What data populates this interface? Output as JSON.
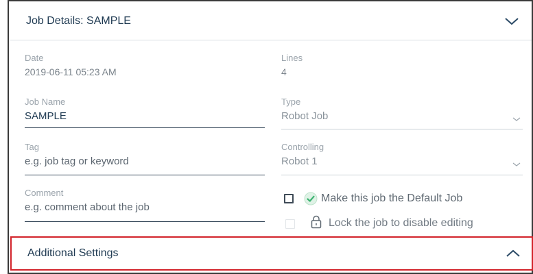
{
  "header": {
    "title": "Job Details: SAMPLE"
  },
  "fields": {
    "date": {
      "label": "Date",
      "value": "2019-06-11 05:23 AM"
    },
    "lines": {
      "label": "Lines",
      "value": "4"
    },
    "job_name": {
      "label": "Job Name",
      "value": "SAMPLE"
    },
    "type": {
      "label": "Type",
      "value": "Robot Job"
    },
    "tag": {
      "label": "Tag",
      "placeholder": "e.g. job tag or keyword"
    },
    "controlling": {
      "label": "Controlling",
      "value": "Robot 1"
    },
    "comment": {
      "label": "Comment",
      "placeholder": "e.g. comment about the job"
    }
  },
  "options": {
    "default_job": {
      "label": "Make this job the Default Job",
      "checked": false
    },
    "lock_job": {
      "label": "Lock the job to disable editing",
      "checked": false,
      "disabled": true
    }
  },
  "additional": {
    "title": "Additional Settings"
  },
  "colors": {
    "accent": "#1f3a52",
    "highlight": "#d2232a",
    "check_green": "#3cb371"
  },
  "icons": {
    "header_toggle": "chevron-down-icon",
    "additional_toggle": "chevron-up-icon",
    "default_job": "check-circle-icon",
    "lock_job": "lock-icon",
    "select": "chevron-down-icon"
  }
}
